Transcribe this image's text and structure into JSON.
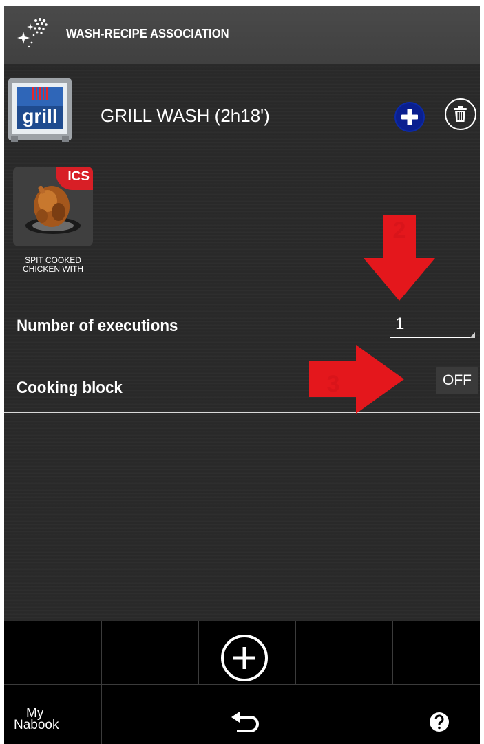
{
  "header": {
    "title": "WASH-RECIPE ASSOCIATION",
    "icon": "sparkle-icon"
  },
  "wash": {
    "title": "GRILL WASH (2h18')",
    "thumb_label": "grill",
    "add_icon": "plus-icon",
    "delete_icon": "trash-icon"
  },
  "recipe": {
    "badge": "ICS",
    "name_line1": "SPIT COOKED",
    "name_line2": "CHICKEN WITH"
  },
  "settings": {
    "executions_label": "Number of executions",
    "executions_value": "1",
    "cooking_block_label": "Cooking block",
    "cooking_block_value": "OFF"
  },
  "annotations": {
    "marker_2": "2",
    "marker_3": "3",
    "color": "#e4171c"
  },
  "toolbar": {
    "add_icon": "add-circle-icon",
    "back_icon": "undo-arrow-icon",
    "help_icon": "help-icon",
    "brand_line1": "My",
    "brand_line2": "Nabook"
  },
  "colors": {
    "accent_blue": "#0a1f8f",
    "badge_red": "#d81f26",
    "background": "#262626"
  }
}
